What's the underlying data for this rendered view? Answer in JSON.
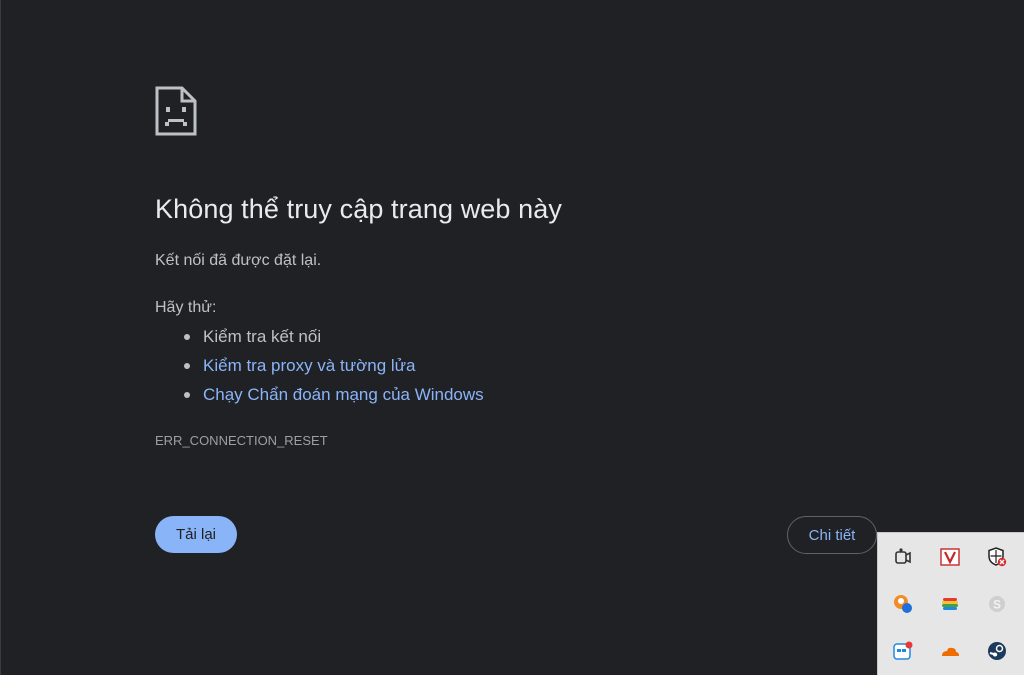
{
  "error_page": {
    "title": "Không thể truy cập trang web này",
    "subtitle": "Kết nối đã được đặt lại.",
    "try_label": "Hãy thử:",
    "suggestions": [
      {
        "label": "Kiểm tra kết nối",
        "is_link": false
      },
      {
        "label": "Kiểm tra proxy và tường lửa",
        "is_link": true
      },
      {
        "label": "Chạy Chẩn đoán mạng của Windows",
        "is_link": true
      }
    ],
    "error_code": "ERR_CONNECTION_RESET",
    "reload_label": "Tải lại",
    "details_label": "Chi tiết",
    "icon": "sad-page-icon"
  },
  "tray": {
    "icons": [
      {
        "name": "meet-now-icon"
      },
      {
        "name": "antivirus-v-icon"
      },
      {
        "name": "security-shield-icon"
      },
      {
        "name": "orange-app-icon"
      },
      {
        "name": "rainbow-circle-icon"
      },
      {
        "name": "skype-icon"
      },
      {
        "name": "calendar-app-icon"
      },
      {
        "name": "cloud-icon"
      },
      {
        "name": "steam-icon"
      }
    ]
  },
  "colors": {
    "background": "#202124",
    "title": "#e8eaed",
    "text": "#bdc1c6",
    "link": "#8ab4f8",
    "button_primary": "#8ab4f8"
  }
}
